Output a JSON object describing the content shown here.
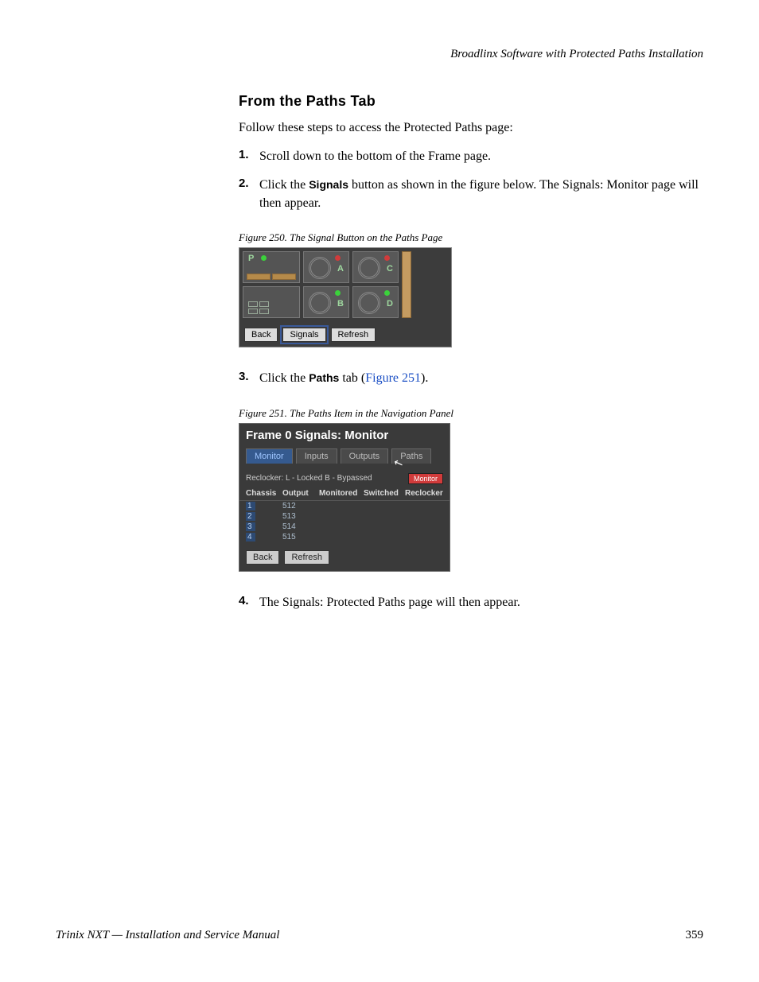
{
  "running_head": "Broadlinx Software with Protected Paths Installation",
  "section_heading": "From the Paths Tab",
  "intro": "Follow these steps to access the Protected Paths page:",
  "steps": {
    "s1": {
      "num": "1.",
      "text": "Scroll down to the bottom of the Frame page."
    },
    "s2": {
      "num": "2.",
      "pre": "Click the ",
      "bold": "Signals",
      "post": " button as shown in the figure below. The Signals: Monitor page will then appear."
    },
    "s3": {
      "num": "3.",
      "pre": "Click the ",
      "bold": "Paths",
      "mid": " tab (",
      "link": "Figure 251",
      "post": ")."
    },
    "s4": {
      "num": "4.",
      "text": "The Signals: Protected Paths page will then appear."
    }
  },
  "fig250": {
    "caption": "Figure 250.  The Signal Button on the Paths Page",
    "p_label": "P",
    "fan_a": "A",
    "fan_b": "B",
    "fan_c": "C",
    "fan_d": "D",
    "btn_back": "Back",
    "btn_signals": "Signals",
    "btn_refresh": "Refresh"
  },
  "fig251": {
    "caption": "Figure 251.  The Paths Item in the Navigation Panel",
    "title": "Frame 0 Signals: Monitor",
    "tabs": {
      "monitor": "Monitor",
      "inputs": "Inputs",
      "outputs": "Outputs",
      "paths": "Paths"
    },
    "reclocker_text": "Reclocker: L - Locked  B - Bypassed",
    "monitor_badge": "Monitor",
    "headers": {
      "chassis": "Chassis",
      "output": "Output",
      "monitored": "Monitored",
      "switched": "Switched",
      "reclocker": "Reclocker"
    },
    "rows": [
      {
        "chassis": "1",
        "output": "512"
      },
      {
        "chassis": "2",
        "output": "513"
      },
      {
        "chassis": "3",
        "output": "514"
      },
      {
        "chassis": "4",
        "output": "515"
      }
    ],
    "btn_back": "Back",
    "btn_refresh": "Refresh"
  },
  "footer": {
    "left": "Trinix NXT  —  Installation and Service Manual",
    "page": "359"
  }
}
